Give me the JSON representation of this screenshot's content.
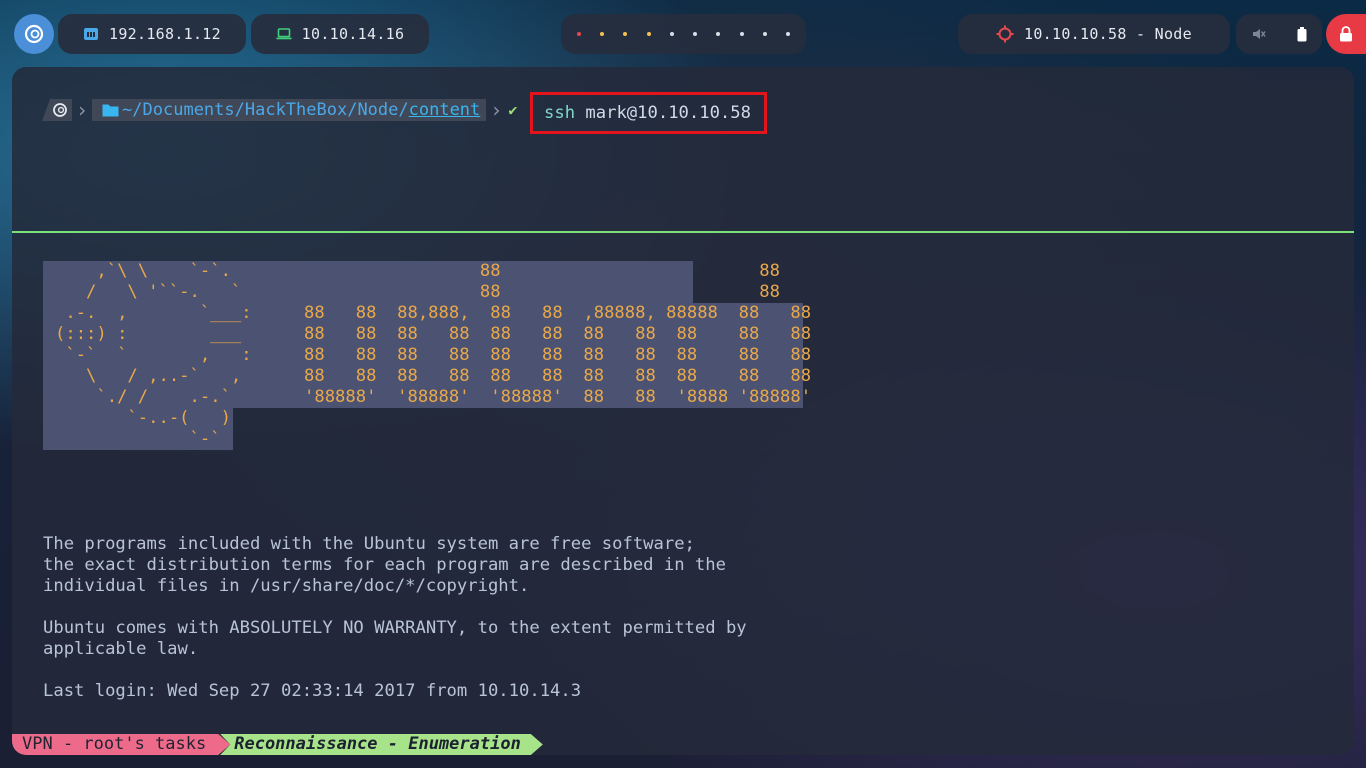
{
  "topbar": {
    "host_ip": "192.168.1.12",
    "vpn_ip": "10.10.14.16",
    "workspace_dot_colors": [
      "#e5484d",
      "#f2c14e",
      "#f2c14e",
      "#f2c14e",
      "#d9dde6",
      "#d9dde6",
      "#d9dde6",
      "#d9dde6",
      "#d9dde6",
      "#d9dde6"
    ],
    "target": "10.10.10.58 - Node",
    "tray_icons": [
      "muted-speaker-icon",
      "battery-icon"
    ],
    "lock_icon": "lock-icon",
    "colors": {
      "lock_button": "#e83a44",
      "target_icon": "#e5484d"
    }
  },
  "terminal": {
    "prompt_path_prefix": "~/Documents/HackTheBox/Node/",
    "prompt_path_current": "content",
    "prompt_ok_symbol": "✔",
    "command": "ssh",
    "command_args": "mark@10.10.10.58",
    "ascii_art": {
      "key": [
        "    ,`\\ \\    `-`.",
        "   /   \\ '``-.   `",
        " .-.  ,       `___:",
        "(:::) :        ___",
        " `-`  `       ,   :",
        "   \\   / ,..-`   ,",
        "    `./ /    .-.`",
        "       `-..-(   )",
        "             `-`"
      ],
      "banner": [
        "                 88                         88",
        "                 88                         88",
        "88   88  88,888,  88   88  ,88888, 88888  88   88",
        "88   88  88   88  88   88  88   88  88    88   88",
        "88   88  88   88  88   88  88   88  88    88   88",
        "88   88  88   88  88   88  88   88  88    88   88",
        "'88888'  '88888'  '88888'  88   88  '8888 '88888'"
      ]
    },
    "motd": [
      "The programs included with the Ubuntu system are free software;",
      "the exact distribution terms for each program are described in the",
      "individual files in /usr/share/doc/*/copyright.",
      "",
      "Ubuntu comes with ABSOLUTELY NO WARRANTY, to the extent permitted by",
      "applicable law.",
      "",
      "Last login: Wed Sep 27 02:33:14 2017 from 10.10.14.3"
    ],
    "highlight_color": "#e4141c",
    "divider_color": "#7be07a"
  },
  "statusline": {
    "session": "VPN - root's tasks",
    "window": "Reconnaissance - Enumeration"
  }
}
